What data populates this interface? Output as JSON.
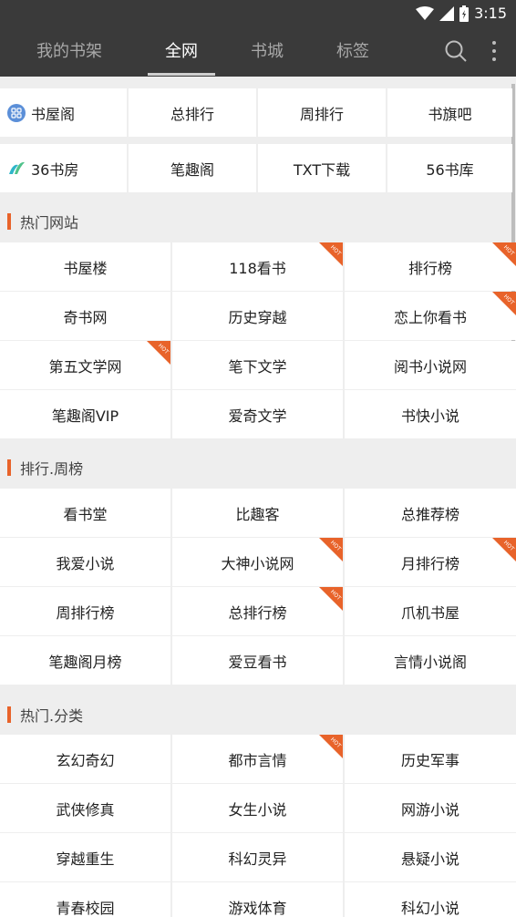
{
  "status_bar": {
    "time": "3:15",
    "icons": [
      "wifi-icon",
      "signal-icon",
      "battery-icon"
    ]
  },
  "nav": {
    "tabs": [
      "我的书架",
      "全网",
      "书城",
      "标签"
    ],
    "active_tab": "全网"
  },
  "quick_links": {
    "row1": [
      {
        "label": "书屋阁",
        "icon": "grid-circle-icon"
      },
      {
        "label": "总排行"
      },
      {
        "label": "周排行"
      },
      {
        "label": "书旗吧"
      }
    ],
    "row2": [
      {
        "label": "36书房",
        "icon": "leaf-logo-icon"
      },
      {
        "label": "笔趣阁"
      },
      {
        "label": "TXT下载"
      },
      {
        "label": "56书库"
      }
    ]
  },
  "sections": [
    {
      "title": "热门网站",
      "rows": [
        [
          {
            "label": "书屋楼",
            "hot": false
          },
          {
            "label": "118看书",
            "hot": true
          },
          {
            "label": "排行榜",
            "hot": true
          }
        ],
        [
          {
            "label": "奇书网",
            "hot": false
          },
          {
            "label": "历史穿越",
            "hot": false
          },
          {
            "label": "恋上你看书",
            "hot": true
          }
        ],
        [
          {
            "label": "第五文学网",
            "hot": true
          },
          {
            "label": "笔下文学",
            "hot": false
          },
          {
            "label": "阅书小说网",
            "hot": false
          }
        ],
        [
          {
            "label": "笔趣阁VIP",
            "hot": false
          },
          {
            "label": "爱奇文学",
            "hot": false
          },
          {
            "label": "书快小说",
            "hot": false
          }
        ]
      ]
    },
    {
      "title": "排行.周榜",
      "rows": [
        [
          {
            "label": "看书堂",
            "hot": false
          },
          {
            "label": "比趣客",
            "hot": false
          },
          {
            "label": "总推荐榜",
            "hot": false
          }
        ],
        [
          {
            "label": "我爱小说",
            "hot": false
          },
          {
            "label": "大神小说网",
            "hot": true
          },
          {
            "label": "月排行榜",
            "hot": true
          }
        ],
        [
          {
            "label": "周排行榜",
            "hot": false
          },
          {
            "label": "总排行榜",
            "hot": true
          },
          {
            "label": "爪机书屋",
            "hot": false
          }
        ],
        [
          {
            "label": "笔趣阁月榜",
            "hot": false
          },
          {
            "label": "爱豆看书",
            "hot": false
          },
          {
            "label": "言情小说阁",
            "hot": false
          }
        ]
      ]
    },
    {
      "title": "热门.分类",
      "rows": [
        [
          {
            "label": "玄幻奇幻",
            "hot": false
          },
          {
            "label": "都市言情",
            "hot": true
          },
          {
            "label": "历史军事",
            "hot": false
          }
        ],
        [
          {
            "label": "武侠修真",
            "hot": false
          },
          {
            "label": "女生小说",
            "hot": false
          },
          {
            "label": "网游小说",
            "hot": false
          }
        ],
        [
          {
            "label": "穿越重生",
            "hot": false
          },
          {
            "label": "科幻灵异",
            "hot": false
          },
          {
            "label": "悬疑小说",
            "hot": false
          }
        ],
        [
          {
            "label": "青春校园",
            "hot": false
          },
          {
            "label": "游戏体育",
            "hot": false
          },
          {
            "label": "科幻小说",
            "hot": false
          }
        ]
      ]
    }
  ],
  "hot_badge_text": "HOT",
  "colors": {
    "header_bg": "#3a3a3a",
    "accent": "#e8632a",
    "page_bg": "#eeeeee"
  }
}
